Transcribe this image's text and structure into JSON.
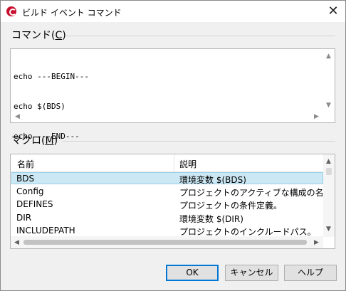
{
  "window": {
    "title": "ビルド イベント コマンド",
    "close_glyph": "✕"
  },
  "command": {
    "label": "コマンド(",
    "accel": "C",
    "label_end": ")",
    "lines": [
      "echo ---BEGIN---",
      "echo $(BDS)",
      "echo ---END---"
    ]
  },
  "macro": {
    "label": "マクロ(",
    "accel": "M",
    "label_end": ")",
    "columns": [
      "名前",
      "説明"
    ],
    "rows": [
      {
        "name": "BDS",
        "desc": "環境変数 $(BDS)",
        "selected": true
      },
      {
        "name": "Config",
        "desc": "プロジェクトのアクティブな構成の名前"
      },
      {
        "name": "DEFINES",
        "desc": "プロジェクトの条件定義。"
      },
      {
        "name": "DIR",
        "desc": "環境変数 $(DIR)"
      },
      {
        "name": "INCLUDEPATH",
        "desc": "プロジェクトのインクルードパス。"
      }
    ]
  },
  "buttons": {
    "ok": "OK",
    "cancel": "キャンセル",
    "help": "ヘルプ"
  },
  "icons": {
    "app": "red-circle-logo-icon",
    "up": "▲",
    "down": "▼",
    "left": "◀",
    "right": "▶"
  }
}
